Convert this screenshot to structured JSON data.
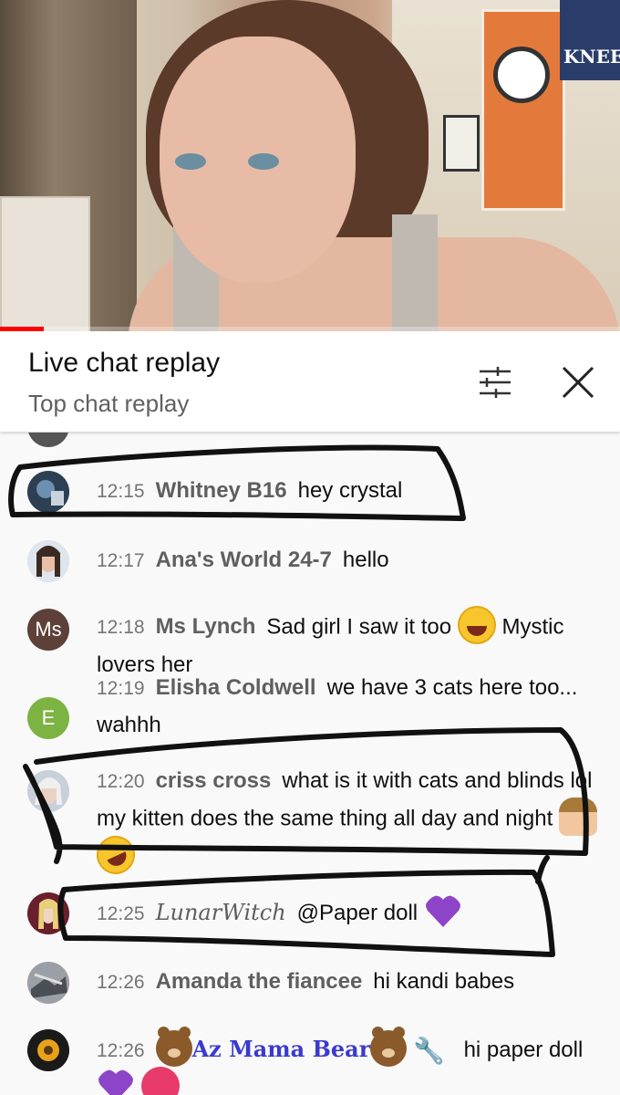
{
  "video": {
    "poster_text": "KNEEL",
    "progress_fraction": 0.07,
    "progress_color": "#ff0000"
  },
  "header": {
    "title": "Live chat replay",
    "subtitle": "Top chat replay",
    "filter_icon": "filter-sliders-icon",
    "close_icon": "close-icon"
  },
  "messages": [
    {
      "time": "12:15",
      "author": "Whitney B16",
      "text": "hey crystal",
      "avatar_color": "#2c3e50"
    },
    {
      "time": "12:17",
      "author": "Ana's World 24-7",
      "text": "hello",
      "avatar_color": "#6b6f7a"
    },
    {
      "time": "12:18",
      "author": "Ms Lynch",
      "text_before": "Sad girl I saw it too",
      "text_after": "Mystic lovers her",
      "avatar_initials": "Ms",
      "avatar_color": "#5d4037"
    },
    {
      "time": "12:19",
      "author": "Elisha Coldwell",
      "text": "we have 3 cats here too... wahhh",
      "avatar_initials": "E",
      "avatar_color": "#7cb342"
    },
    {
      "time": "12:20",
      "author": "criss cross",
      "text": "what is it with cats and blinds lol my kitten does the same thing all day and night",
      "avatar_color": "#b0b6c2"
    },
    {
      "time": "12:25",
      "author": "LunarWitch",
      "text": "@Paper doll",
      "avatar_color": "#8a2a3a"
    },
    {
      "time": "12:26",
      "author": "Amanda the fiancee",
      "text": "hi kandi babes",
      "avatar_color": "#8a8f96"
    },
    {
      "time": "12:26",
      "author": "Az Mama Bear",
      "text": "hi paper doll",
      "avatar_color": "#1a1a1a"
    }
  ],
  "colors": {
    "purple_heart": "#8e44c9",
    "annotation_ink": "#111111"
  }
}
